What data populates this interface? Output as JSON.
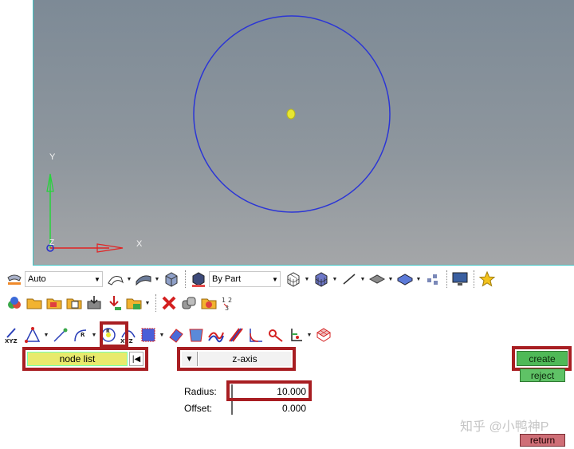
{
  "viewport": {
    "axis_y_label": "Y",
    "axis_x_label": "X",
    "axis_z_label": "Z",
    "circle_color": "#2b35d6",
    "node_color": "#e8e631"
  },
  "toolbar1": {
    "display_mode": "Auto",
    "color_mode": "By Part"
  },
  "panel": {
    "node_list_label": "node list",
    "axis_value": "z-axis",
    "radius_label": "Radius:",
    "radius_value": "10.000",
    "offset_label": "Offset:",
    "offset_value": "0.000",
    "create_label": "create",
    "reject_label": "reject",
    "return_label": "return"
  },
  "watermark": "知乎 @小鸭神P",
  "colors": {
    "highlight": "#a81e22",
    "create": "#4fb957",
    "return": "#cf6f77"
  }
}
